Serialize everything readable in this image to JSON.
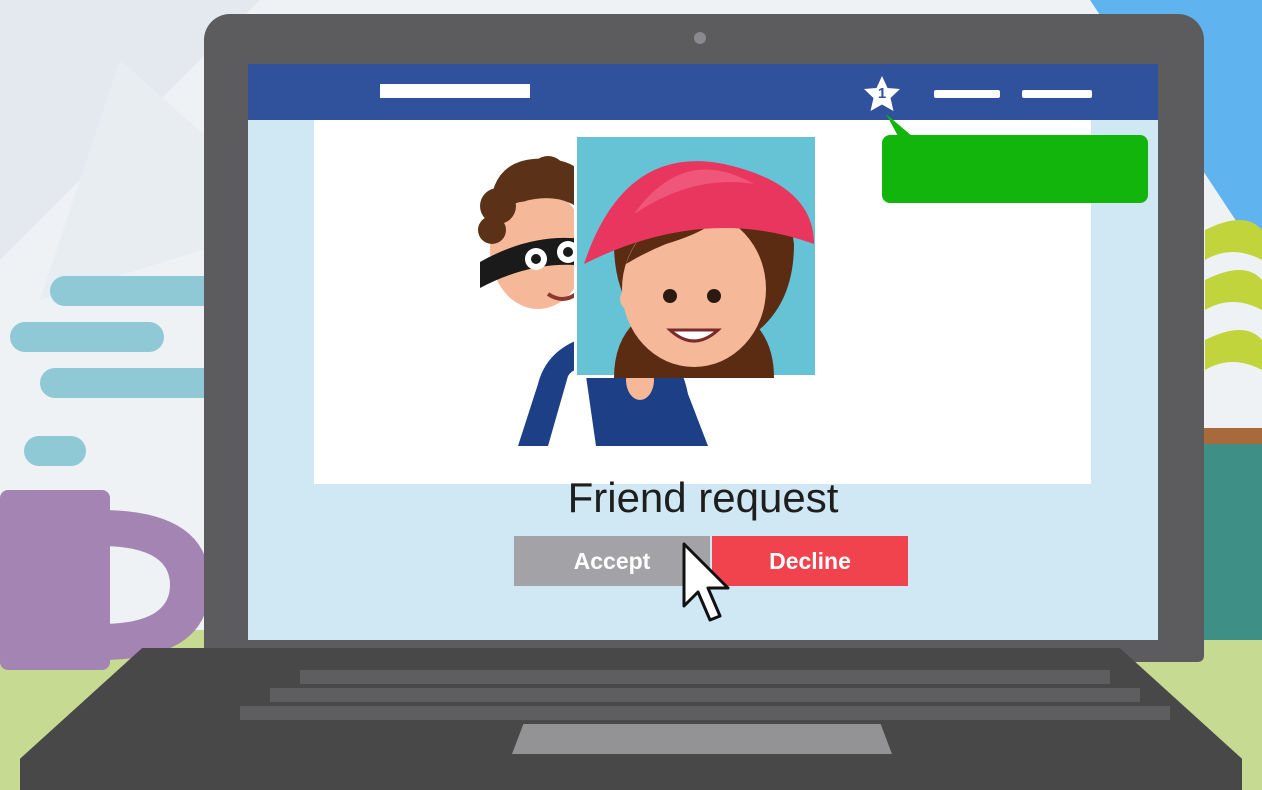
{
  "dialog": {
    "title": "Friend request",
    "accept_label": "Accept",
    "decline_label": "Decline"
  },
  "notification": {
    "count": "1"
  },
  "icons": {
    "notification": "star-icon",
    "cursor": "mouse-pointer-icon"
  },
  "colors": {
    "topbar": "#30519c",
    "accept": "#a3a3a7",
    "decline": "#f1434d",
    "notification_bubble": "#12b50c",
    "screen": "#cfe8f3"
  }
}
